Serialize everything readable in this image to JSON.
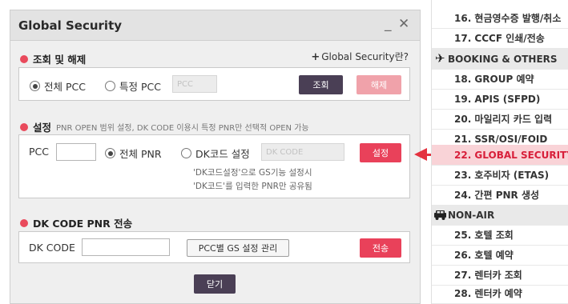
{
  "dialog": {
    "title": "Global Security",
    "minimize_icon": "_",
    "close_icon": "✕"
  },
  "lookup": {
    "title": "조회 및 해제",
    "help_link_prefix": "+",
    "help_link": "Global Security란?",
    "radio_all": "전체 PCC",
    "radio_specific": "특정 PCC",
    "pcc_placeholder": "PCC",
    "search_button": "조회",
    "release_button": "해제"
  },
  "settings": {
    "title": "설정",
    "description": "PNR OPEN 범위 설정, DK CODE 이용시 특정 PNR만 선택적 OPEN 가능",
    "pcc_label": "PCC",
    "pcc_value": "",
    "radio_all_pnr": "전체 PNR",
    "radio_dk_code": "DK코드 설정",
    "dk_code_placeholder": "DK CODE",
    "set_button": "설정",
    "note_line1": "'DK코드설정'으로 GS기능 설정시",
    "note_line2": "'DK코드'를 입력한 PNR만 공유됨"
  },
  "dk_transfer": {
    "title": "DK CODE PNR 전송",
    "label": "DK CODE",
    "value": "",
    "manage_button": "PCC별 GS 설정 관리",
    "send_button": "전송"
  },
  "close_button": "닫기",
  "menu": {
    "items_top": [
      {
        "label": "16. 현금영수증 발행/취소"
      },
      {
        "label": "17. CCCF 인쇄/전송"
      }
    ],
    "category_booking": "BOOKING & OTHERS",
    "items_booking": [
      {
        "label": "18. GROUP 예약"
      },
      {
        "label": "19. APIS (SFPD)"
      },
      {
        "label": "20. 마일리지 카드 입력"
      },
      {
        "label": "21. SSR/OSI/FOID"
      },
      {
        "label": "22. GLOBAL SECURITY"
      },
      {
        "label": "23. 호주비자 (ETAS)"
      },
      {
        "label": "24. 간편 PNR 생성"
      }
    ],
    "category_nonair": "NON-AIR",
    "items_nonair": [
      {
        "label": "25. 호텔 조회"
      },
      {
        "label": "26. 호텔 예약"
      },
      {
        "label": "27. 렌터카 조회"
      },
      {
        "label": "28. 렌터카 예약"
      }
    ],
    "active_item": "22. GLOBAL SECURITY"
  },
  "colors": {
    "accent_red": "#e9415a",
    "arrow_red": "#e4323f",
    "active_bg": "#f9d3d7",
    "dark_button": "#4a3f55",
    "disabled_button": "#f0a2aa"
  },
  "icons": {
    "section_marker": "red-dot-icon",
    "booking_category": "airplane-icon",
    "nonair_category": "car-icon"
  }
}
